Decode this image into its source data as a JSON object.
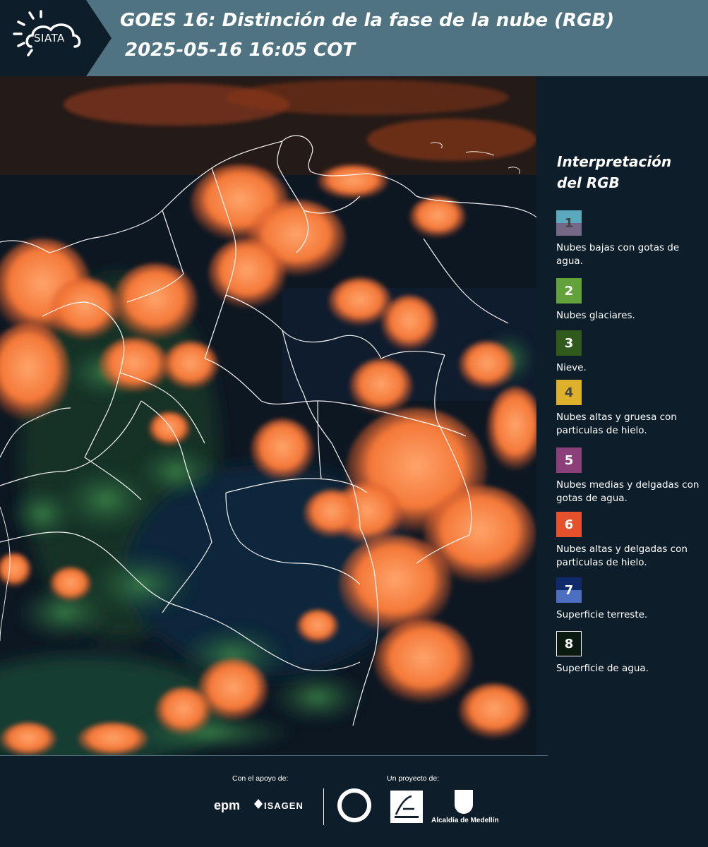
{
  "header": {
    "logo_text": "SIATA",
    "title_line1": "GOES 16: Distinción de la fase de la nube (RGB)",
    "title_line2": "2025-05-16 16:05 COT"
  },
  "legend": {
    "title": "Interpretación del RGB",
    "items": [
      {
        "number": "1",
        "text": "Nubes bajas con gotas de agua.",
        "color_top": "#5aa9bf",
        "color_bottom": "#746886",
        "num_color": "#444444"
      },
      {
        "number": "2",
        "text": "Nubes glaciares.",
        "color_top": "#63a23b",
        "color_bottom": "#63a23b",
        "num_color": "#ffffff"
      },
      {
        "number": "3",
        "text": "Nieve.",
        "color_top": "#2f5a1c",
        "color_bottom": "#2f5a1c",
        "num_color": "#ffffff"
      },
      {
        "number": "4",
        "text": "Nubes altas y gruesa con particulas de hielo.",
        "color_top": "#dfb02a",
        "color_bottom": "#dfb02a",
        "num_color": "#444444"
      },
      {
        "number": "5",
        "text": "Nubes medias y delgadas con gotas de agua.",
        "color_top": "#8c4079",
        "color_bottom": "#8c4079",
        "num_color": "#ffffff"
      },
      {
        "number": "6",
        "text": "Nubes altas y delgadas con particulas de hielo.",
        "color_top": "#e4512a",
        "color_bottom": "#e4512a",
        "num_color": "#ffffff"
      },
      {
        "number": "7",
        "text": "Superficie terreste.",
        "color_top": "#0f2a6a",
        "color_bottom": "#4c6fc0",
        "num_color": "#ffffff"
      },
      {
        "number": "8",
        "text": "Superficie de agua.",
        "color_top": "#0a1a10",
        "color_bottom": "#0a1a10",
        "num_color": "#ffffff"
      }
    ]
  },
  "footer": {
    "support_label": "Con el apoyo de:",
    "project_label": "Un proyecto de:",
    "sponsor1": "epm",
    "sponsor2": "ISAGEN",
    "partner_alcaldia": "Alcaldía de Medellín"
  },
  "colors": {
    "header_bg": "#4f7380",
    "page_bg": "#0d1e2a",
    "cloud_orange": "#f07838",
    "land_dark": "#0e1a2c",
    "vegetation": "#2f6a3a"
  }
}
